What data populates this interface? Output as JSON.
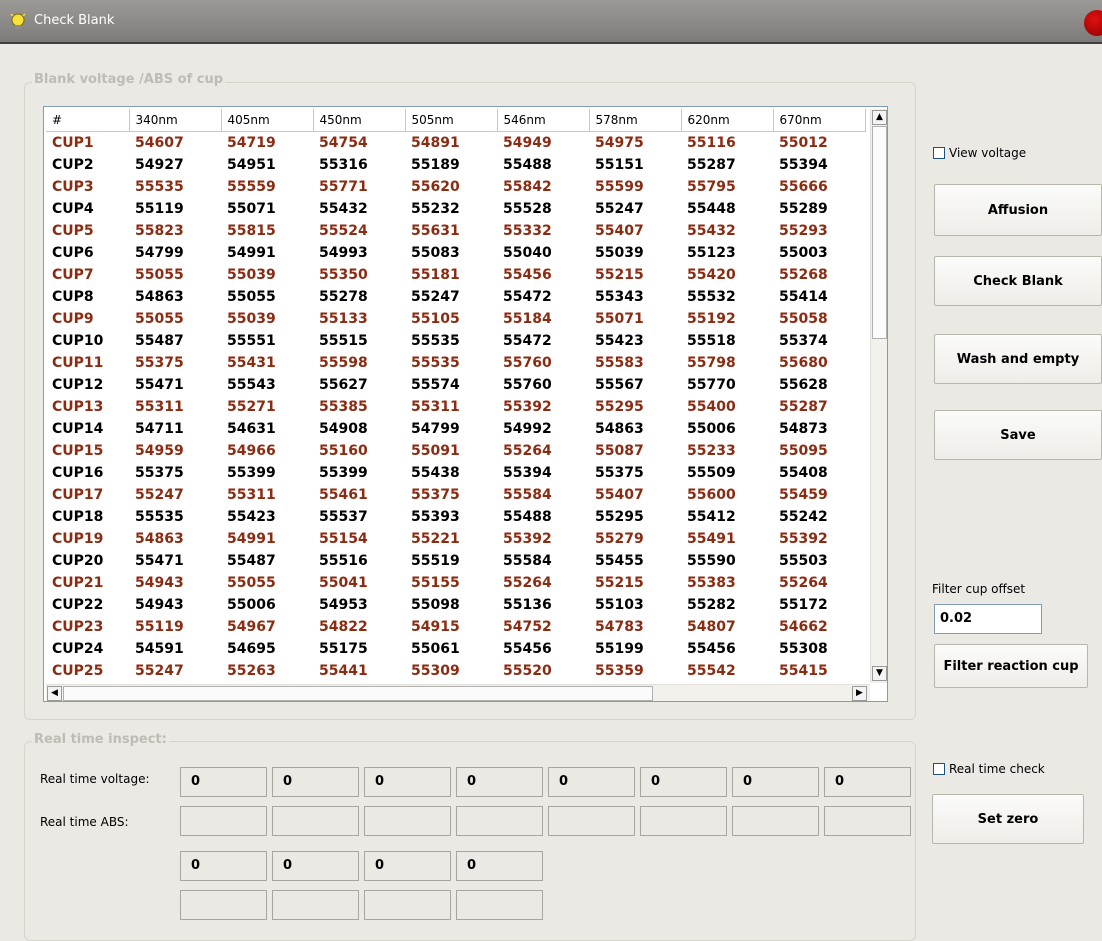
{
  "window": {
    "title": "Check Blank"
  },
  "blank_group": {
    "title": "Blank voltage /ABS of  cup"
  },
  "table": {
    "headers": [
      "#",
      "340nm",
      "405nm",
      "450nm",
      "505nm",
      "546nm",
      "578nm",
      "620nm",
      "670nm"
    ],
    "rows": [
      [
        "CUP1",
        "54607",
        "54719",
        "54754",
        "54891",
        "54949",
        "54975",
        "55116",
        "55012"
      ],
      [
        "CUP2",
        "54927",
        "54951",
        "55316",
        "55189",
        "55488",
        "55151",
        "55287",
        "55394"
      ],
      [
        "CUP3",
        "55535",
        "55559",
        "55771",
        "55620",
        "55842",
        "55599",
        "55795",
        "55666"
      ],
      [
        "CUP4",
        "55119",
        "55071",
        "55432",
        "55232",
        "55528",
        "55247",
        "55448",
        "55289"
      ],
      [
        "CUP5",
        "55823",
        "55815",
        "55524",
        "55631",
        "55332",
        "55407",
        "55432",
        "55293"
      ],
      [
        "CUP6",
        "54799",
        "54991",
        "54993",
        "55083",
        "55040",
        "55039",
        "55123",
        "55003"
      ],
      [
        "CUP7",
        "55055",
        "55039",
        "55350",
        "55181",
        "55456",
        "55215",
        "55420",
        "55268"
      ],
      [
        "CUP8",
        "54863",
        "55055",
        "55278",
        "55247",
        "55472",
        "55343",
        "55532",
        "55414"
      ],
      [
        "CUP9",
        "55055",
        "55039",
        "55133",
        "55105",
        "55184",
        "55071",
        "55192",
        "55058"
      ],
      [
        "CUP10",
        "55487",
        "55551",
        "55515",
        "55535",
        "55472",
        "55423",
        "55518",
        "55374"
      ],
      [
        "CUP11",
        "55375",
        "55431",
        "55598",
        "55535",
        "55760",
        "55583",
        "55798",
        "55680"
      ],
      [
        "CUP12",
        "55471",
        "55543",
        "55627",
        "55574",
        "55760",
        "55567",
        "55770",
        "55628"
      ],
      [
        "CUP13",
        "55311",
        "55271",
        "55385",
        "55311",
        "55392",
        "55295",
        "55400",
        "55287"
      ],
      [
        "CUP14",
        "54711",
        "54631",
        "54908",
        "54799",
        "54992",
        "54863",
        "55006",
        "54873"
      ],
      [
        "CUP15",
        "54959",
        "54966",
        "55160",
        "55091",
        "55264",
        "55087",
        "55233",
        "55095"
      ],
      [
        "CUP16",
        "55375",
        "55399",
        "55399",
        "55438",
        "55394",
        "55375",
        "55509",
        "55408"
      ],
      [
        "CUP17",
        "55247",
        "55311",
        "55461",
        "55375",
        "55584",
        "55407",
        "55600",
        "55459"
      ],
      [
        "CUP18",
        "55535",
        "55423",
        "55537",
        "55393",
        "55488",
        "55295",
        "55412",
        "55242"
      ],
      [
        "CUP19",
        "54863",
        "54991",
        "55154",
        "55221",
        "55392",
        "55279",
        "55491",
        "55392"
      ],
      [
        "CUP20",
        "55471",
        "55487",
        "55516",
        "55519",
        "55584",
        "55455",
        "55590",
        "55503"
      ],
      [
        "CUP21",
        "54943",
        "55055",
        "55041",
        "55155",
        "55264",
        "55215",
        "55383",
        "55264"
      ],
      [
        "CUP22",
        "54943",
        "55006",
        "54953",
        "55098",
        "55136",
        "55103",
        "55282",
        "55172"
      ],
      [
        "CUP23",
        "55119",
        "54967",
        "54822",
        "54915",
        "54752",
        "54783",
        "54807",
        "54662"
      ],
      [
        "CUP24",
        "54591",
        "54695",
        "55175",
        "55061",
        "55456",
        "55199",
        "55456",
        "55308"
      ],
      [
        "CUP25",
        "55247",
        "55263",
        "55441",
        "55309",
        "55520",
        "55359",
        "55542",
        "55415"
      ]
    ]
  },
  "side": {
    "view_voltage": "View voltage",
    "affusion": "Affusion",
    "check_blank": "Check Blank",
    "wash_and_empty": "Wash and empty",
    "save": "Save",
    "filter_offset_label": "Filter cup  offset",
    "filter_offset_value": "0.02",
    "filter_reaction_cup": "Filter reaction cup",
    "real_time_check": "Real time check",
    "set_zero": "Set zero"
  },
  "realtime": {
    "title": "Real time inspect:",
    "voltage_label": "Real time voltage:",
    "abs_label": "Real time ABS:",
    "voltage_values": [
      "0",
      "0",
      "0",
      "0",
      "0",
      "0",
      "0",
      "0"
    ],
    "abs_values": [
      "",
      "",
      "",
      "",
      "",
      "",
      "",
      ""
    ],
    "voltage_values_2": [
      "0",
      "0",
      "0",
      "0"
    ],
    "abs_values_2": [
      "",
      "",
      "",
      ""
    ]
  }
}
